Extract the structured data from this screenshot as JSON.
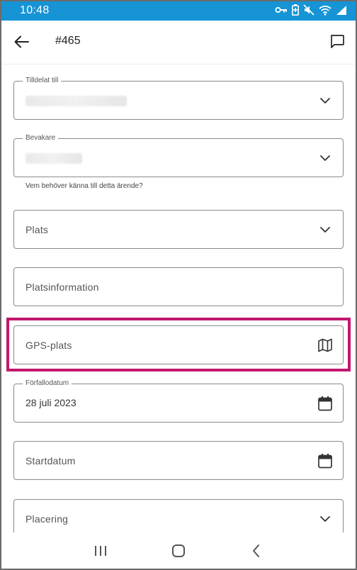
{
  "status_bar": {
    "time": "10:48",
    "icons": [
      "vpn-key-icon",
      "battery-saver-icon",
      "mute-icon",
      "wifi-icon",
      "signal-icon"
    ]
  },
  "app_bar": {
    "title": "#465",
    "back_icon": "arrow-left-icon",
    "action_icon": "chat-bubble-icon"
  },
  "form": {
    "assigned_to": {
      "label": "Tilldelat till",
      "value_redacted": true
    },
    "watchers": {
      "label": "Bevakare",
      "value_redacted": true,
      "helper": "Vem behöver känna till detta ärende?"
    },
    "location": {
      "placeholder": "Plats"
    },
    "location_info": {
      "placeholder": "Platsinformation"
    },
    "gps_location": {
      "placeholder": "GPS-plats",
      "highlighted": true
    },
    "due_date": {
      "label": "Förfallodatum",
      "value": "28 juli 2023"
    },
    "start_date": {
      "placeholder": "Startdatum"
    },
    "placement": {
      "placeholder": "Placering"
    }
  },
  "colors": {
    "status_bar": "#1694d6",
    "highlight": "#c2186f",
    "field_border": "#8a8a8a"
  },
  "nav_bar": {
    "icons": [
      "recent-apps-icon",
      "home-icon",
      "back-icon"
    ]
  }
}
